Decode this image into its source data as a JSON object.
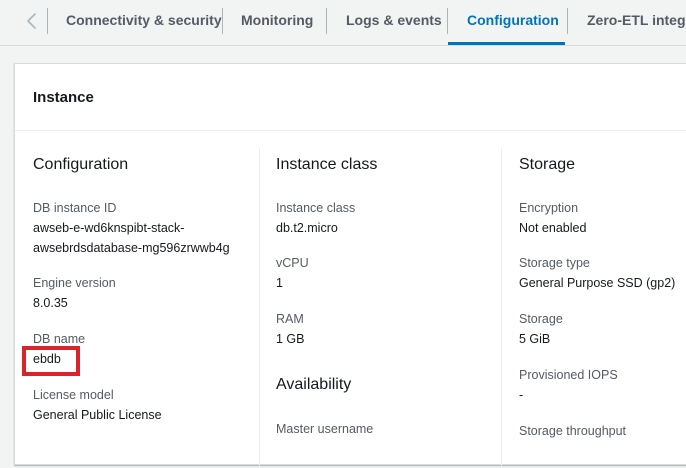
{
  "tabs": [
    {
      "label": "Connectivity & security",
      "active": false
    },
    {
      "label": "Monitoring",
      "active": false
    },
    {
      "label": "Logs & events",
      "active": false
    },
    {
      "label": "Configuration",
      "active": true
    },
    {
      "label": "Zero-ETL integra",
      "active": false
    }
  ],
  "colors": {
    "accent": "#0073bb",
    "highlight": "#d9252a",
    "label": "#545b64",
    "text": "#16191f"
  },
  "panel": {
    "title": "Instance"
  },
  "configuration": {
    "title": "Configuration",
    "fields": [
      {
        "label": "DB instance ID",
        "value_line1": "awseb-e-wd6knspibt-stack-",
        "value_line2": "awsebrdsdatabase-mg596zrwwb4g"
      },
      {
        "label": "Engine version",
        "value": "8.0.35"
      },
      {
        "label": "DB name",
        "value": "ebdb"
      },
      {
        "label": "License model",
        "value": "General Public License"
      }
    ]
  },
  "instance_class": {
    "title": "Instance class",
    "fields": [
      {
        "label": "Instance class",
        "value": "db.t2.micro"
      },
      {
        "label": "vCPU",
        "value": "1"
      },
      {
        "label": "RAM",
        "value": "1 GB"
      }
    ]
  },
  "availability": {
    "title": "Availability",
    "fields": [
      {
        "label": "Master username"
      }
    ]
  },
  "storage": {
    "title": "Storage",
    "fields": [
      {
        "label": "Encryption",
        "value": "Not enabled"
      },
      {
        "label": "Storage type",
        "value": "General Purpose SSD (gp2)"
      },
      {
        "label": "Storage",
        "value": "5 GiB"
      },
      {
        "label": "Provisioned IOPS",
        "value": "-"
      },
      {
        "label": "Storage throughput"
      }
    ]
  }
}
